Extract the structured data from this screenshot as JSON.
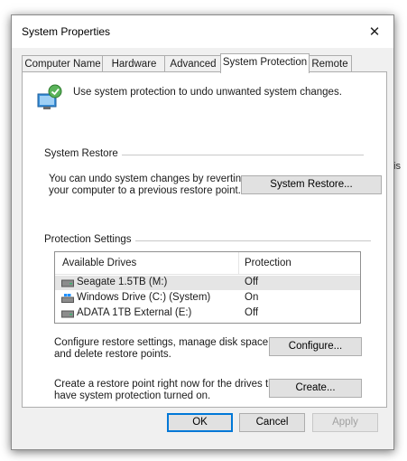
{
  "window": {
    "title": "System Properties",
    "close_glyph": "✕"
  },
  "tabs": [
    {
      "label": "Computer Name",
      "active": false
    },
    {
      "label": "Hardware",
      "active": false
    },
    {
      "label": "Advanced",
      "active": false
    },
    {
      "label": "System Protection",
      "active": true
    },
    {
      "label": "Remote",
      "active": false
    }
  ],
  "intro": {
    "icon": "system-protection-shield-icon",
    "text": "Use system protection to undo unwanted system changes."
  },
  "system_restore": {
    "group_label": "System Restore",
    "description_line1": "You can undo system changes by reverting",
    "description_line2": "your computer to a previous restore point.",
    "button_label": "System Restore..."
  },
  "protection_settings": {
    "group_label": "Protection Settings",
    "columns": [
      "Available Drives",
      "Protection"
    ],
    "drives": [
      {
        "name": "Seagate 1.5TB (M:)",
        "protection": "Off",
        "selected": true,
        "icon": "drive-icon"
      },
      {
        "name": "Windows Drive (C:) (System)",
        "protection": "On",
        "selected": false,
        "icon": "windows-drive-icon"
      },
      {
        "name": "ADATA 1TB External (E:)",
        "protection": "Off",
        "selected": false,
        "icon": "drive-icon"
      }
    ],
    "configure_line1": "Configure restore settings, manage disk space,",
    "configure_line2": "and delete restore points.",
    "configure_label": "Configure...",
    "create_line1": "Create a restore point right now for the drives that",
    "create_line2": "have system protection turned on.",
    "create_label": "Create..."
  },
  "footer": {
    "ok_label": "OK",
    "cancel_label": "Cancel",
    "apply_label": "Apply"
  },
  "background": {
    "partial_text": "is"
  },
  "colors": {
    "accent": "#0078d7",
    "panel": "#ffffff",
    "window": "#f0f0f0"
  }
}
